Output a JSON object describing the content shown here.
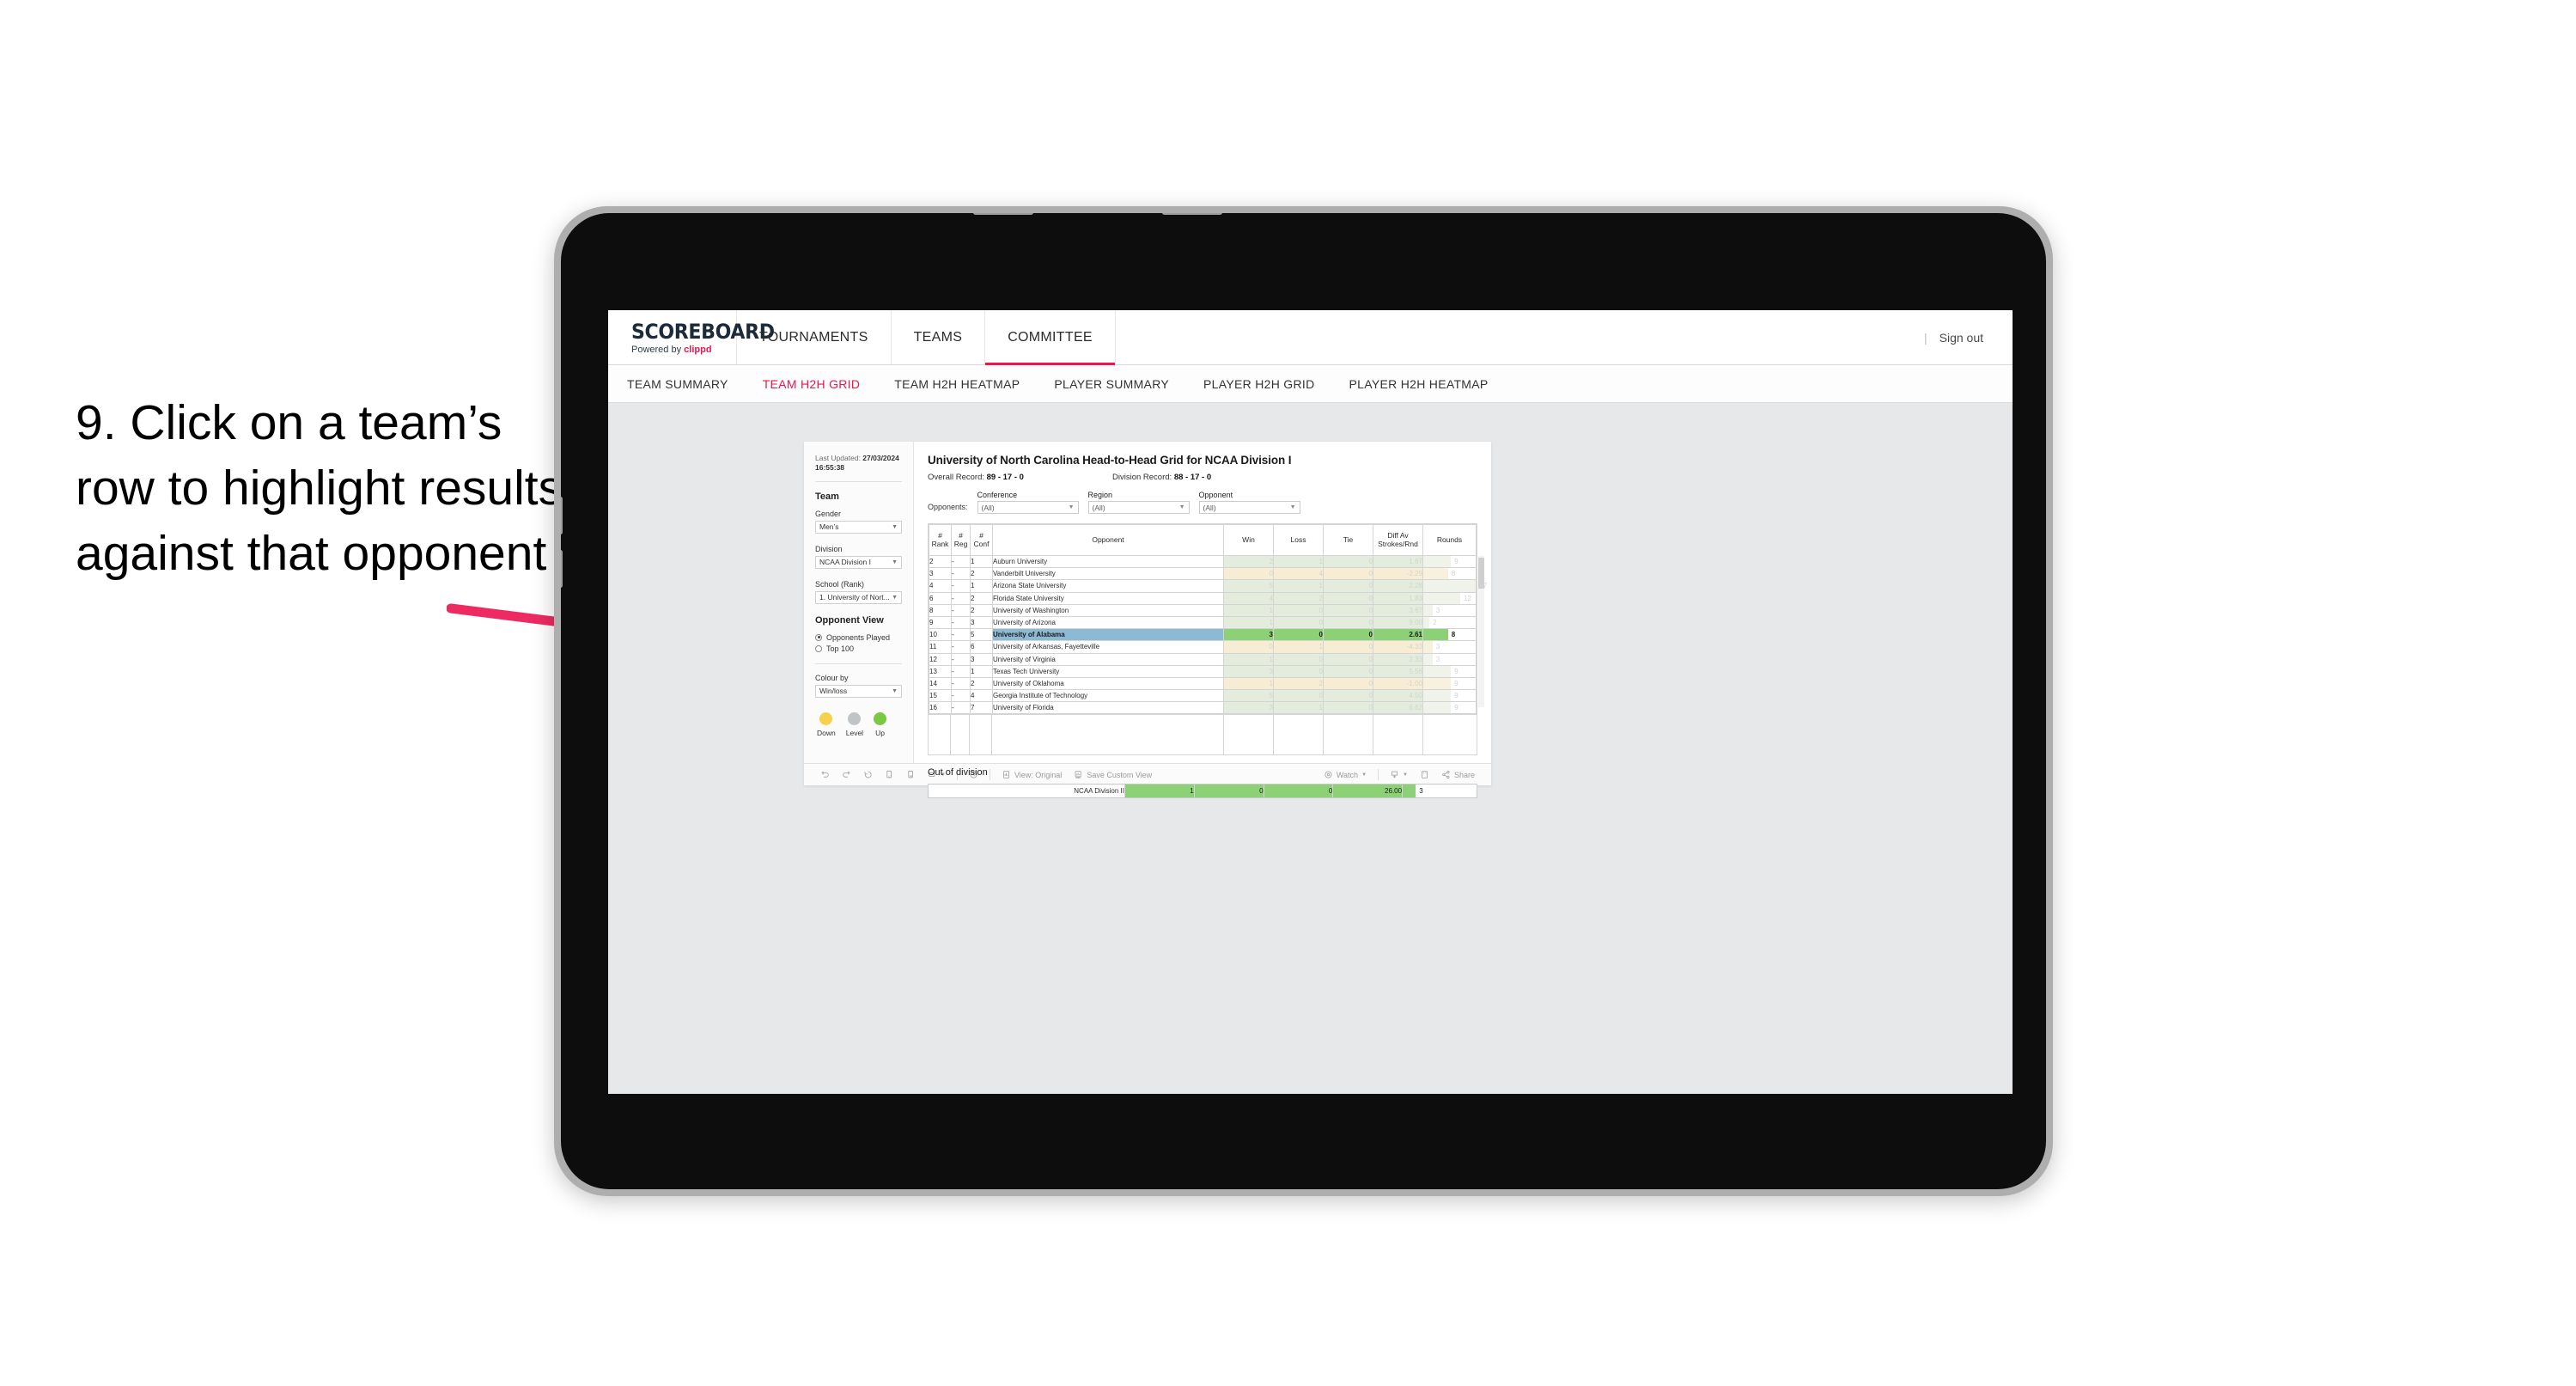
{
  "annotation": {
    "text": "9. Click on a team’s row to highlight results against that opponent",
    "arrow_color": "#ed2b62"
  },
  "app": {
    "logo": {
      "word": "SCOREBOARD",
      "powered_prefix": "Powered by ",
      "brand": "clippd"
    },
    "top_nav": [
      {
        "label": "TOURNAMENTS",
        "active": false
      },
      {
        "label": "TEAMS",
        "active": false
      },
      {
        "label": "COMMITTEE",
        "active": true
      }
    ],
    "sign_out": "Sign out",
    "sign_out_divider": "|",
    "sub_nav": [
      {
        "label": "TEAM SUMMARY",
        "active": false
      },
      {
        "label": "TEAM H2H GRID",
        "active": true
      },
      {
        "label": "TEAM H2H HEATMAP",
        "active": false
      },
      {
        "label": "PLAYER SUMMARY",
        "active": false
      },
      {
        "label": "PLAYER H2H GRID",
        "active": false
      },
      {
        "label": "PLAYER H2H HEATMAP",
        "active": false
      }
    ],
    "accent_color": "#e8174c"
  },
  "sidebar": {
    "last_updated_label": "Last Updated: ",
    "last_updated_value": "27/03/2024 16:55:38",
    "team_heading": "Team",
    "gender": {
      "label": "Gender",
      "value": "Men’s"
    },
    "division": {
      "label": "Division",
      "value": "NCAA Division I"
    },
    "school": {
      "label": "School (Rank)",
      "value": "1. University of Nort..."
    },
    "opponent_view": {
      "heading": "Opponent View",
      "options": [
        {
          "label": "Opponents Played",
          "selected": true
        },
        {
          "label": "Top 100",
          "selected": false
        }
      ]
    },
    "colour_by": {
      "label": "Colour by",
      "value": "Win/loss"
    },
    "legend": [
      {
        "label": "Down",
        "color": "#f5d14e"
      },
      {
        "label": "Level",
        "color": "#c0c4c6"
      },
      {
        "label": "Up",
        "color": "#7ac943"
      }
    ]
  },
  "main": {
    "title": "University of North Carolina Head-to-Head Grid for NCAA Division I",
    "overall_record_label": "Overall Record: ",
    "overall_record_value": "89 - 17 - 0",
    "division_record_label": "Division Record: ",
    "division_record_value": "88 - 17 - 0",
    "opponents_label": "Opponents:",
    "filters": [
      {
        "label": "Conference",
        "value": "(All)"
      },
      {
        "label": "Region",
        "value": "(All)"
      },
      {
        "label": "Opponent",
        "value": "(All)"
      }
    ]
  },
  "chart_data": {
    "type": "table",
    "title": "University of North Carolina Head-to-Head Grid for NCAA Division I",
    "columns": [
      "# Rank",
      "# Reg",
      "# Conf",
      "Opponent",
      "Win",
      "Loss",
      "Tie",
      "Diff Av Strokes/Rnd",
      "Rounds"
    ],
    "header_lines": {
      "rank": [
        "#",
        "Rank"
      ],
      "reg": [
        "#",
        "Reg"
      ],
      "conf": [
        "#",
        "Conf"
      ],
      "opponent": "Opponent",
      "win": "Win",
      "loss": "Loss",
      "tie": "Tie",
      "diff": [
        "Diff Av",
        "Strokes/Rnd"
      ],
      "rounds": "Rounds"
    },
    "rounds_max": 17,
    "rows": [
      {
        "rank": "2",
        "reg": "-",
        "conf": "1",
        "opponent": "Auburn University",
        "win": "2",
        "loss": "1",
        "tie": "0",
        "diff": "1.67",
        "rounds": "9",
        "tone": "up",
        "selected": false
      },
      {
        "rank": "3",
        "reg": "-",
        "conf": "2",
        "opponent": "Vanderbilt University",
        "win": "0",
        "loss": "4",
        "tie": "0",
        "diff": "-2.29",
        "rounds": "8",
        "tone": "down",
        "selected": false
      },
      {
        "rank": "4",
        "reg": "-",
        "conf": "1",
        "opponent": "Arizona State University",
        "win": "5",
        "loss": "1",
        "tie": "0",
        "diff": "2.28",
        "rounds": "17",
        "tone": "up",
        "selected": false
      },
      {
        "rank": "6",
        "reg": "-",
        "conf": "2",
        "opponent": "Florida State University",
        "win": "4",
        "loss": "2",
        "tie": "0",
        "diff": "1.83",
        "rounds": "12",
        "tone": "up",
        "selected": false
      },
      {
        "rank": "8",
        "reg": "-",
        "conf": "2",
        "opponent": "University of Washington",
        "win": "1",
        "loss": "0",
        "tie": "0",
        "diff": "3.67",
        "rounds": "3",
        "tone": "up",
        "selected": false
      },
      {
        "rank": "9",
        "reg": "-",
        "conf": "3",
        "opponent": "University of Arizona",
        "win": "1",
        "loss": "0",
        "tie": "0",
        "diff": "9.00",
        "rounds": "2",
        "tone": "up",
        "selected": false
      },
      {
        "rank": "10",
        "reg": "-",
        "conf": "5",
        "opponent": "University of Alabama",
        "win": "3",
        "loss": "0",
        "tie": "0",
        "diff": "2.61",
        "rounds": "8",
        "tone": "up",
        "selected": true
      },
      {
        "rank": "11",
        "reg": "-",
        "conf": "6",
        "opponent": "University of Arkansas, Fayetteville",
        "win": "0",
        "loss": "1",
        "tie": "0",
        "diff": "-4.33",
        "tone": "down",
        "rounds": "3",
        "selected": false
      },
      {
        "rank": "12",
        "reg": "-",
        "conf": "3",
        "opponent": "University of Virginia",
        "win": "1",
        "loss": "0",
        "tie": "0",
        "diff": "2.33",
        "rounds": "3",
        "tone": "up",
        "selected": false
      },
      {
        "rank": "13",
        "reg": "-",
        "conf": "1",
        "opponent": "Texas Tech University",
        "win": "3",
        "loss": "0",
        "tie": "0",
        "diff": "5.56",
        "rounds": "9",
        "tone": "up",
        "selected": false
      },
      {
        "rank": "14",
        "reg": "-",
        "conf": "2",
        "opponent": "University of Oklahoma",
        "win": "1",
        "loss": "2",
        "tie": "0",
        "diff": "-1.00",
        "rounds": "9",
        "tone": "down",
        "selected": false
      },
      {
        "rank": "15",
        "reg": "-",
        "conf": "4",
        "opponent": "Georgia Institute of Technology",
        "win": "5",
        "loss": "0",
        "tie": "0",
        "diff": "4.50",
        "rounds": "9",
        "tone": "up",
        "selected": false
      },
      {
        "rank": "16",
        "reg": "-",
        "conf": "7",
        "opponent": "University of Florida",
        "win": "3",
        "loss": "1",
        "tie": "0",
        "diff": "6.62",
        "rounds": "9",
        "tone": "up",
        "selected": false
      }
    ],
    "colors": {
      "up_fill": "#e4ecdd",
      "down_fill": "#f7edd4",
      "selected_row": "#8cb9d3",
      "selected_fill": "#8dd176",
      "bar_dim_up": "#eff3ea",
      "bar_dim_down": "#f8f1dd"
    }
  },
  "out_of_division": {
    "title": "Out of division",
    "row": {
      "name": "NCAA Division II",
      "win": "1",
      "loss": "0",
      "tie": "0",
      "diff": "26.00",
      "rounds": "3"
    }
  },
  "toolbar": {
    "items": [
      {
        "name": "undo",
        "icon": "undo-icon",
        "label": ""
      },
      {
        "name": "redo",
        "icon": "redo-icon",
        "label": ""
      },
      {
        "name": "revert",
        "icon": "revert-icon",
        "label": ""
      },
      {
        "name": "refresh",
        "icon": "refresh-data-icon",
        "label": ""
      },
      {
        "name": "pause",
        "icon": "pause-updates-icon",
        "label": ""
      },
      {
        "name": "device-layout",
        "icon": "device-layout-icon",
        "label": ""
      },
      {
        "name": "alerts",
        "icon": "alerts-clock-icon",
        "label": ""
      },
      {
        "name": "view-original",
        "icon": "view-icon",
        "label": "View: Original"
      },
      {
        "name": "save-custom-view",
        "icon": "save-view-icon",
        "label": "Save Custom View"
      },
      {
        "name": "watch",
        "icon": "watch-icon",
        "label": "Watch"
      },
      {
        "name": "download",
        "icon": "download-icon",
        "label": ""
      },
      {
        "name": "fullscreen",
        "icon": "fullscreen-icon",
        "label": ""
      },
      {
        "name": "share",
        "icon": "share-icon",
        "label": "Share"
      }
    ]
  }
}
